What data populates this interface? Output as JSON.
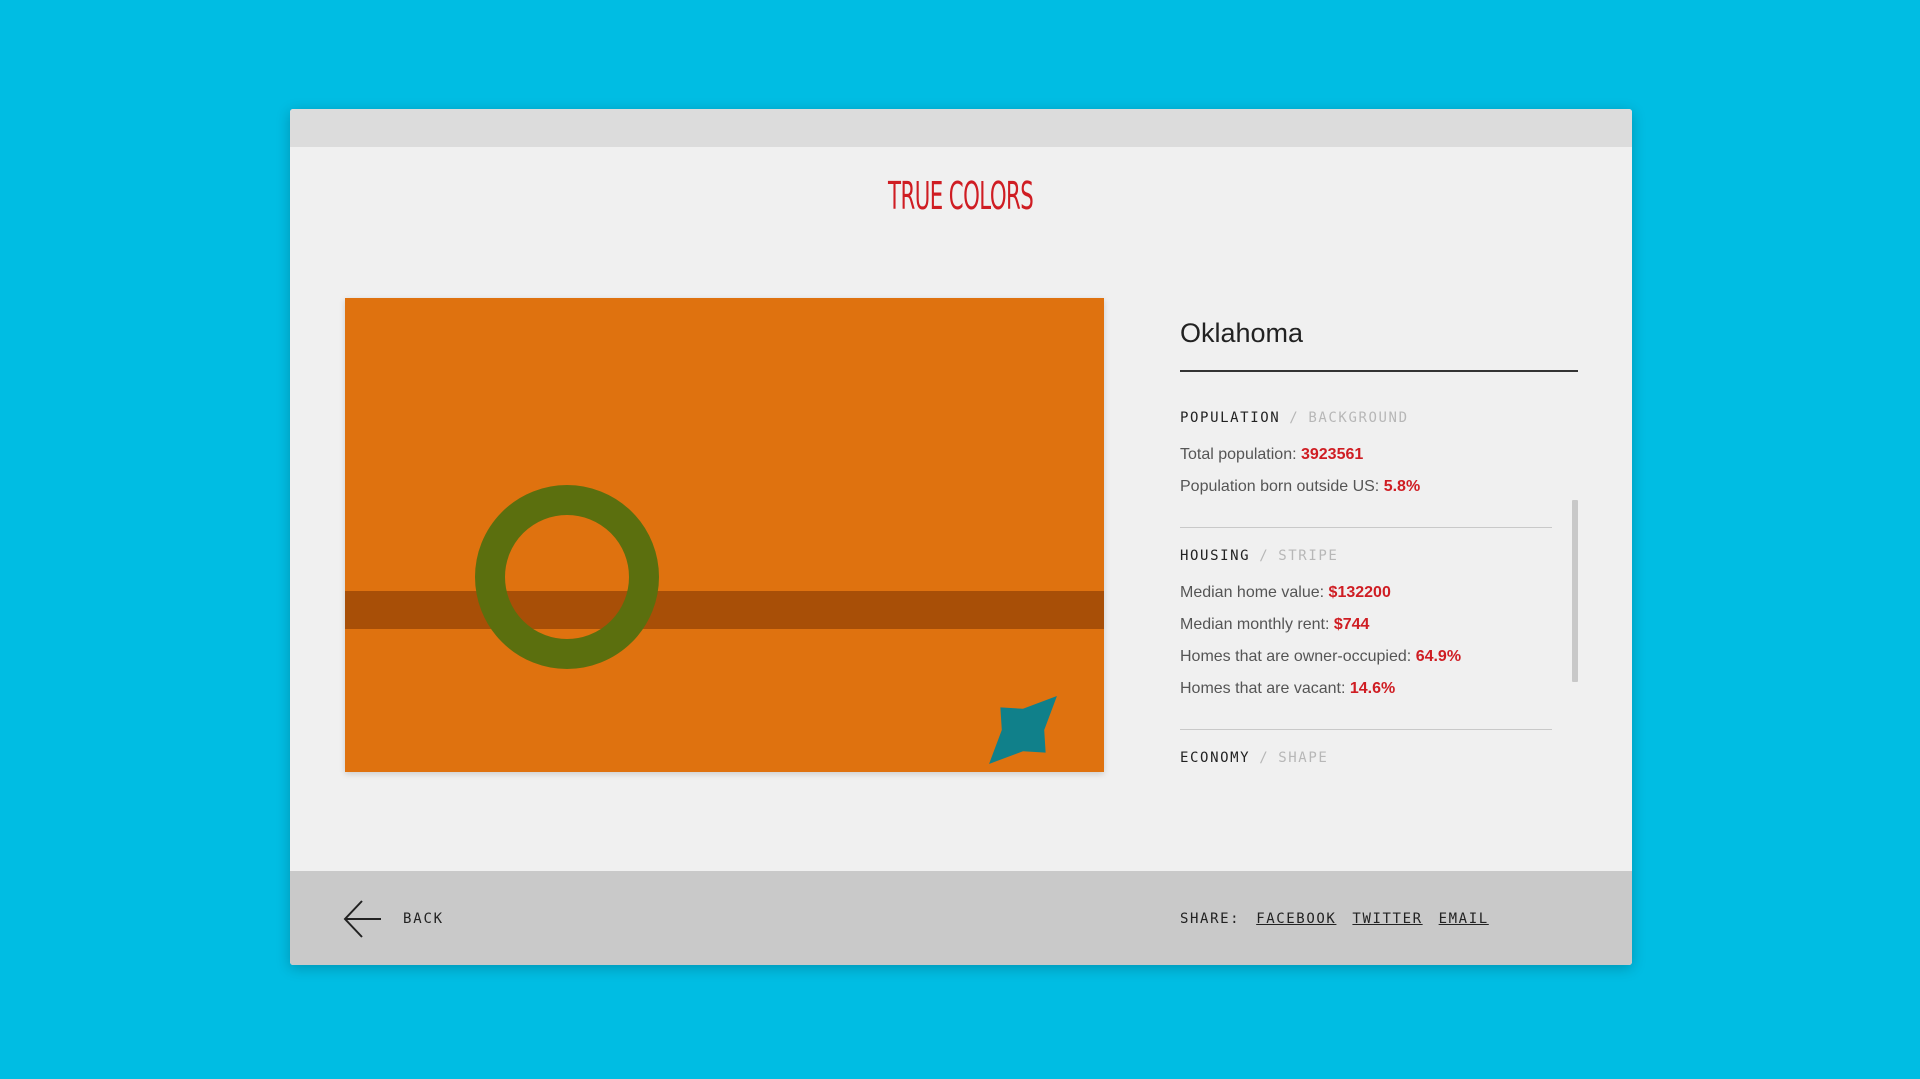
{
  "app": {
    "logo_text": "TRUE COLORS"
  },
  "colors": {
    "page_background": "#00bde3",
    "accent": "#cf1d23",
    "flag_background": "#df720f",
    "flag_stripe": "#a84f07",
    "flag_ring": "#5b6f0e",
    "flag_star": "#10808a"
  },
  "state": {
    "name": "Oklahoma"
  },
  "sections": [
    {
      "title": "POPULATION",
      "subtitle": "BACKGROUND",
      "stats": [
        {
          "label": "Total population:",
          "value": "3923561"
        },
        {
          "label": "Population born outside US:",
          "value": "5.8%"
        }
      ]
    },
    {
      "title": "HOUSING",
      "subtitle": "STRIPE",
      "stats": [
        {
          "label": "Median home value:",
          "value": "$132200"
        },
        {
          "label": "Median monthly rent:",
          "value": "$744"
        },
        {
          "label": "Homes that are owner-occupied:",
          "value": "64.9%"
        },
        {
          "label": "Homes that are vacant:",
          "value": "14.6%"
        }
      ]
    },
    {
      "title": "ECONOMY",
      "subtitle": "SHAPE",
      "stats": []
    }
  ],
  "footer": {
    "back_label": "BACK",
    "share_label": "SHARE:",
    "share_links": [
      "FACEBOOK",
      "TWITTER",
      "EMAIL"
    ]
  },
  "icons": {
    "back": "arrow-left-icon"
  }
}
